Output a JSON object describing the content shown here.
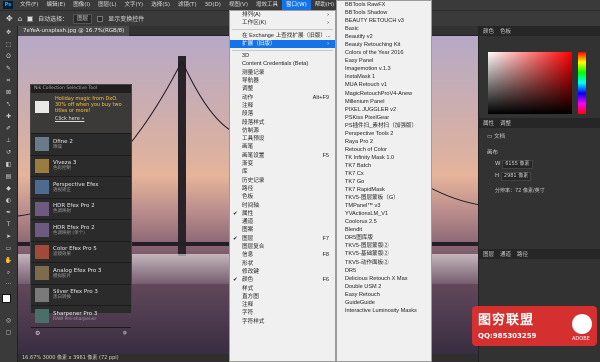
{
  "menubar": {
    "app_icon": "Ps",
    "items": [
      "文件(F)",
      "编辑(E)",
      "图像(I)",
      "图层(L)",
      "文字(Y)",
      "选择(S)",
      "滤镜(T)",
      "3D(D)",
      "视图(V)",
      "增效工具",
      "窗口(W)",
      "帮助(H)"
    ],
    "active_index": 10
  },
  "options": {
    "auto_select_label": "自动选择：",
    "layer_value": "图层",
    "transform_label": "显示变换控件"
  },
  "document": {
    "tab": "7eYeA-unsplash.jpg @ 16.7%(RGB/8)",
    "status": "16.67%    3000 像素 x 3961 像素 (72 ppi)"
  },
  "nik": {
    "header": "Nik Collection Selective Tool",
    "promo_text": "Holiday magic from DxO. 30% off when you buy two titles or more!",
    "promo_link": "Click here »",
    "plugins": [
      {
        "name": "Dfine 2",
        "sub": "降噪",
        "color": "#6b7a8a"
      },
      {
        "name": "Viveza 3",
        "sub": "色彩控制",
        "color": "#9a7d3e"
      },
      {
        "name": "Perspective Efex",
        "sub": "透视矫正",
        "color": "#4e6a8f"
      },
      {
        "name": "HDR Efex Pro 2",
        "sub": "色调映射",
        "color": "#6d5a7e"
      },
      {
        "name": "HDR Efex Pro 2",
        "sub": "色调映射 (单个)",
        "color": "#6d5a7e"
      },
      {
        "name": "Color Efex Pro 5",
        "sub": "滤镜效果",
        "color": "#a14a3a"
      },
      {
        "name": "Analog Efex Pro 3",
        "sub": "模拟胶片",
        "color": "#7e6a4c"
      },
      {
        "name": "Silver Efex Pro 3",
        "sub": "黑白转换",
        "color": "#7a7a7a"
      },
      {
        "name": "Sharpener Pro 3",
        "sub": "RAW Pre-sharpener",
        "color": "#4a6e6a"
      }
    ]
  },
  "window_menu": {
    "items": [
      {
        "label": "排列(A)",
        "shortcut": "",
        "sub": true
      },
      {
        "label": "工作区(K)",
        "shortcut": "",
        "sub": true
      },
      {
        "sep": true
      },
      {
        "label": "在 Exchange 上查找扩展（旧版）...",
        "shortcut": ""
      },
      {
        "label": "扩展（旧版）",
        "shortcut": "",
        "sub": true,
        "highlight": true
      },
      {
        "sep": true
      },
      {
        "label": "3D",
        "shortcut": ""
      },
      {
        "label": "Content Credentials (Beta)",
        "shortcut": ""
      },
      {
        "label": "测量记录",
        "shortcut": ""
      },
      {
        "label": "导航器",
        "shortcut": ""
      },
      {
        "label": "调整",
        "shortcut": ""
      },
      {
        "label": "动作",
        "shortcut": "Alt+F9"
      },
      {
        "label": "注释",
        "shortcut": ""
      },
      {
        "label": "段落",
        "shortcut": ""
      },
      {
        "label": "段落样式",
        "shortcut": ""
      },
      {
        "label": "仿制源",
        "shortcut": ""
      },
      {
        "label": "工具预设",
        "shortcut": ""
      },
      {
        "label": "画笔",
        "shortcut": ""
      },
      {
        "label": "画笔设置",
        "shortcut": "F5"
      },
      {
        "label": "渐变",
        "shortcut": ""
      },
      {
        "label": "库",
        "shortcut": ""
      },
      {
        "label": "历史记录",
        "shortcut": ""
      },
      {
        "label": "路径",
        "shortcut": ""
      },
      {
        "label": "色板",
        "shortcut": ""
      },
      {
        "label": "时间轴",
        "shortcut": ""
      },
      {
        "label": "属性",
        "shortcut": "",
        "checked": true
      },
      {
        "label": "通道",
        "shortcut": ""
      },
      {
        "label": "图案",
        "shortcut": ""
      },
      {
        "label": "图层",
        "shortcut": "F7",
        "checked": true
      },
      {
        "label": "图层复合",
        "shortcut": ""
      },
      {
        "label": "信息",
        "shortcut": "F8"
      },
      {
        "label": "形状",
        "shortcut": ""
      },
      {
        "label": "修改键",
        "shortcut": ""
      },
      {
        "label": "颜色",
        "shortcut": "F6",
        "checked": true
      },
      {
        "label": "样式",
        "shortcut": ""
      },
      {
        "label": "直方图",
        "shortcut": ""
      },
      {
        "label": "注释",
        "shortcut": ""
      },
      {
        "label": "字符",
        "shortcut": ""
      },
      {
        "label": "字符样式",
        "shortcut": ""
      }
    ]
  },
  "ext_menu": {
    "items": [
      "BBTools RawFX",
      "BBTools Shadow",
      "BEAUTY RETOUCH v3",
      "Basic",
      "Beautify v2",
      "Beauty Retouching Kit",
      "Colors of the Year 2016",
      "Easy Panel",
      "Imagemotion v.1.3",
      "InstaMask 1",
      "MUA Retouch v1",
      "MagicRetouchProV4-Anew",
      "Millenium Panel",
      "PIXEL JUGGLER v2",
      "PSKiss PixelGear",
      "PS插件扫_素材扫（加强版）",
      "Perspective Tools 2",
      "Raya Pro 2",
      "Retouch of Color",
      "TK Infinity Mask 1.0",
      "TK7 Batch",
      "TK7 Cx",
      "TK7 Go",
      "TK7 RapidMask",
      "TKV5-图层蒙板（G）",
      "TMPanel™ v3",
      "YVActionsLM_V1",
      "Coolorus 2.5",
      "Blendit",
      "DR5图库版",
      "TKV5-图层蒙版②",
      "TKV5-基础蒙版②",
      "TKV5-动作面板②",
      "DR5",
      "Delicious Retouch X Max",
      "Double USM 2",
      "Easy Retouch",
      "GuideGuide",
      "Interactive Luminosity Masks"
    ]
  },
  "panels": {
    "color_tab": "颜色",
    "swatch_tab": "色板",
    "props_tab": "属性",
    "adj_tab": "调整",
    "doc_label": "文档",
    "canvas_label": "画布",
    "w_label": "W",
    "w_value": "6155 像素",
    "h_label": "H",
    "h_value": "2981 像素",
    "res_label": "分辨率：72 像素/英寸",
    "layers_tab": "图层",
    "channels_tab": "通道",
    "paths_tab": "路径",
    "fg_color": "#ffffff",
    "bg_color": "#000000"
  },
  "watermark": {
    "title": "图穷联盟",
    "qq": "QQ:985303259",
    "tag": "ADOBE"
  }
}
